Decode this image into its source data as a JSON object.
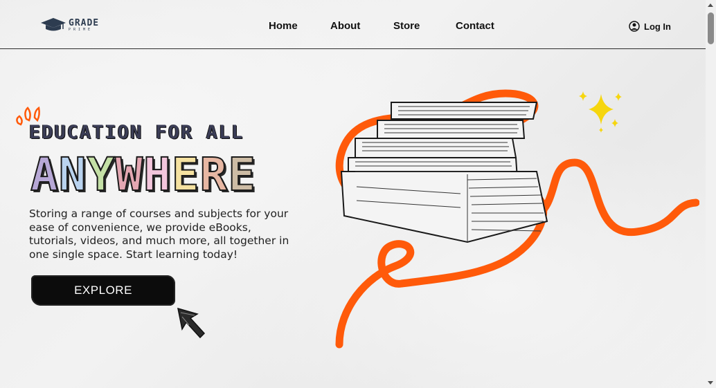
{
  "brand": {
    "name": "GRADE",
    "sub": "PRIME"
  },
  "nav": {
    "items": [
      {
        "label": "Home"
      },
      {
        "label": "About"
      },
      {
        "label": "Store"
      },
      {
        "label": "Contact"
      }
    ]
  },
  "login": {
    "label": "Log In",
    "icon": "user-circle-icon"
  },
  "hero": {
    "tagline": "EDUCATION FOR ALL",
    "headline_letters": [
      {
        "ch": "A",
        "color": "#b7a8d6"
      },
      {
        "ch": "N",
        "color": "#b9d3ef"
      },
      {
        "ch": "Y",
        "color": "#c4e0a6"
      },
      {
        "ch": "W",
        "color": "#e4a7b2"
      },
      {
        "ch": "H",
        "color": "#f3c6dc"
      },
      {
        "ch": "E",
        "color": "#f5e1a0"
      },
      {
        "ch": "R",
        "color": "#e7b7a3"
      },
      {
        "ch": "E",
        "color": "#cdbca5"
      }
    ],
    "description": "Storing a range of courses and subjects for your ease of convenience, we provide eBooks, tutorials, videos, and much more, all together in one single space. Start learning today!",
    "cta_label": "EXPLORE"
  },
  "colors": {
    "accent": "#ff5a0a",
    "sparkle": "#f6d60e",
    "ink": "#111111"
  }
}
